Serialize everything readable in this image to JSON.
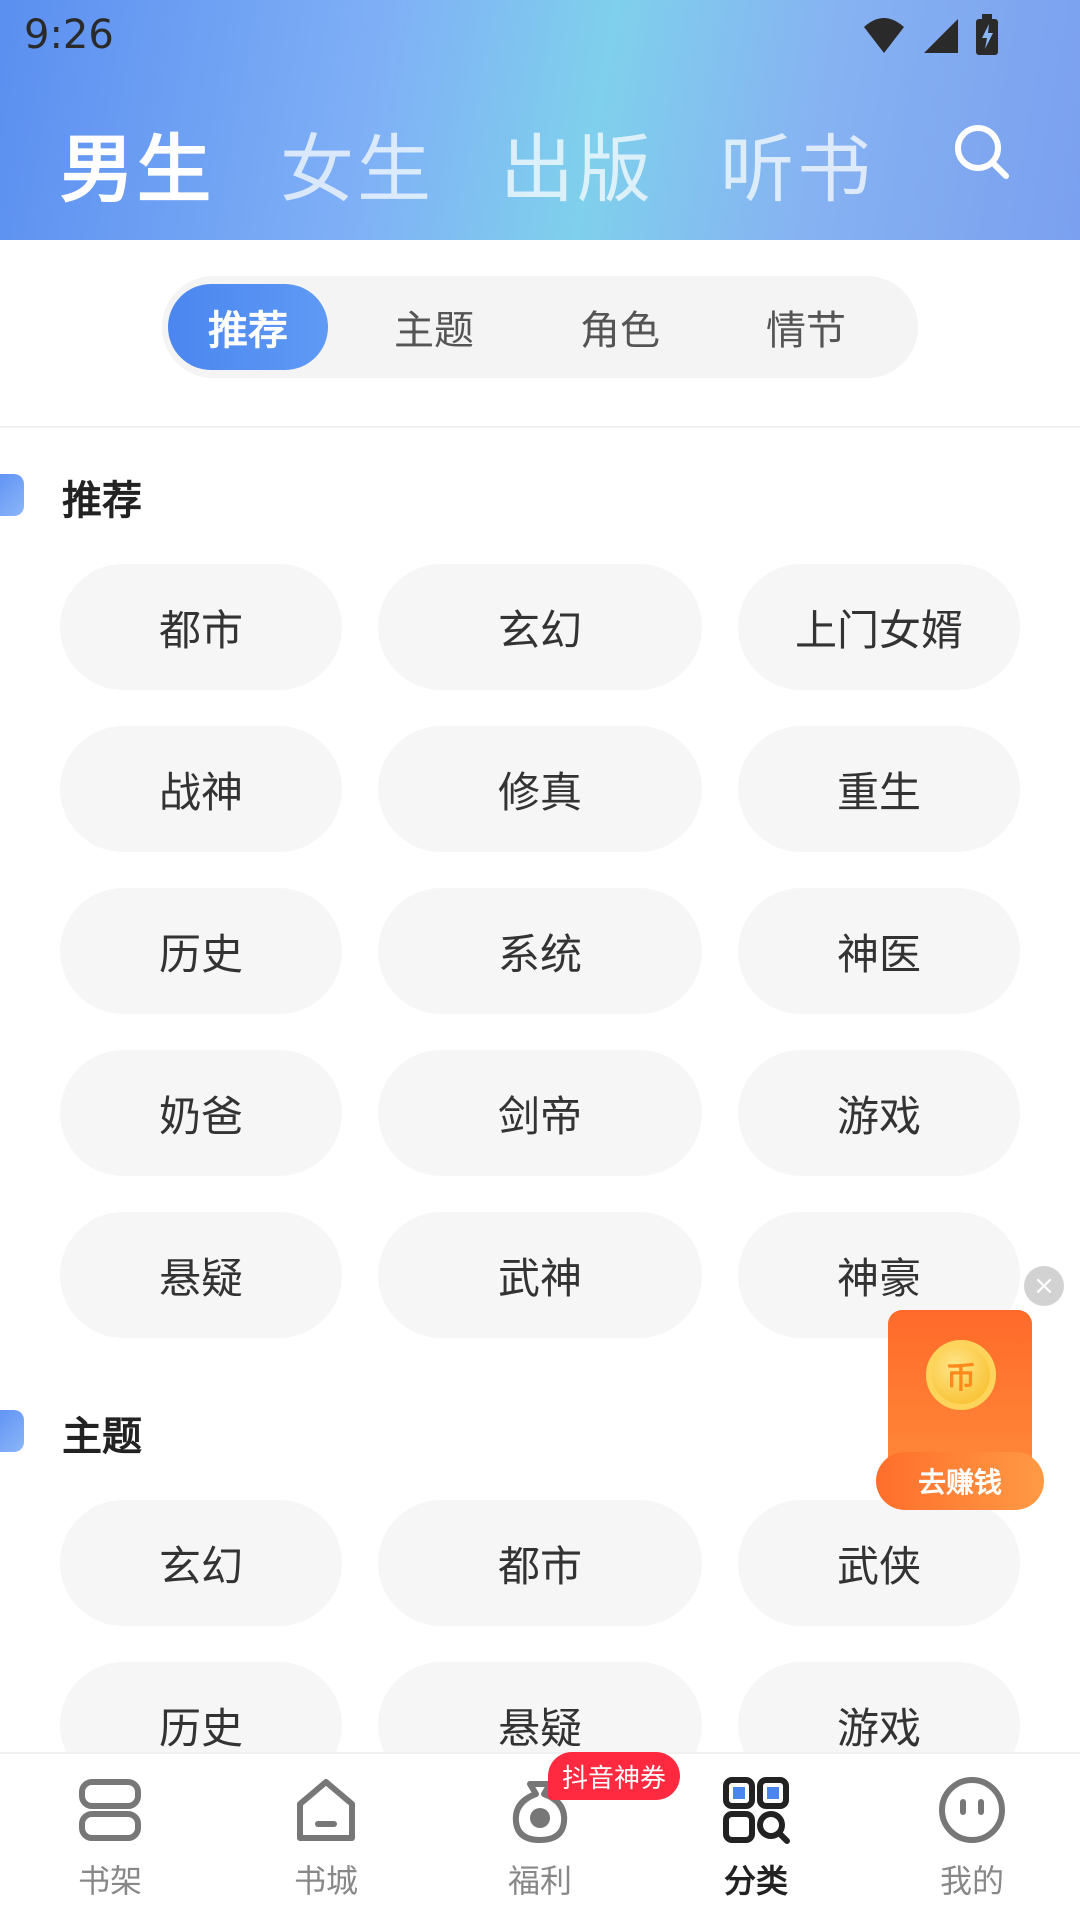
{
  "status_bar": {
    "time": "9:26"
  },
  "top_tabs": [
    {
      "label": "男生",
      "active": true
    },
    {
      "label": "女生",
      "active": false
    },
    {
      "label": "出版",
      "active": false
    },
    {
      "label": "听书",
      "active": false
    }
  ],
  "segments": [
    {
      "label": "推荐",
      "active": true
    },
    {
      "label": "主题",
      "active": false
    },
    {
      "label": "角色",
      "active": false
    },
    {
      "label": "情节",
      "active": false
    }
  ],
  "sections": [
    {
      "title": "推荐",
      "tags": [
        "都市",
        "玄幻",
        "上门女婿",
        "战神",
        "修真",
        "重生",
        "历史",
        "系统",
        "神医",
        "奶爸",
        "剑帝",
        "游戏",
        "悬疑",
        "武神",
        "神豪"
      ]
    },
    {
      "title": "主题",
      "tags": [
        "玄幻",
        "都市",
        "武侠",
        "历史",
        "悬疑",
        "游戏"
      ]
    }
  ],
  "float_ad": {
    "coin_symbol": "币",
    "button_label": "去赚钱"
  },
  "bottom_nav": {
    "items": [
      {
        "label": "书架",
        "icon": "bookshelf-icon",
        "active": false
      },
      {
        "label": "书城",
        "icon": "home-icon",
        "active": false
      },
      {
        "label": "福利",
        "icon": "money-bag-icon",
        "active": false
      },
      {
        "label": "分类",
        "icon": "category-icon",
        "active": true
      },
      {
        "label": "我的",
        "icon": "profile-face-icon",
        "active": false
      }
    ],
    "badge": "抖音神券"
  },
  "colors": {
    "accent": "#4b86ef",
    "badge": "#ff2a3f",
    "earn": "#ff7a30"
  }
}
